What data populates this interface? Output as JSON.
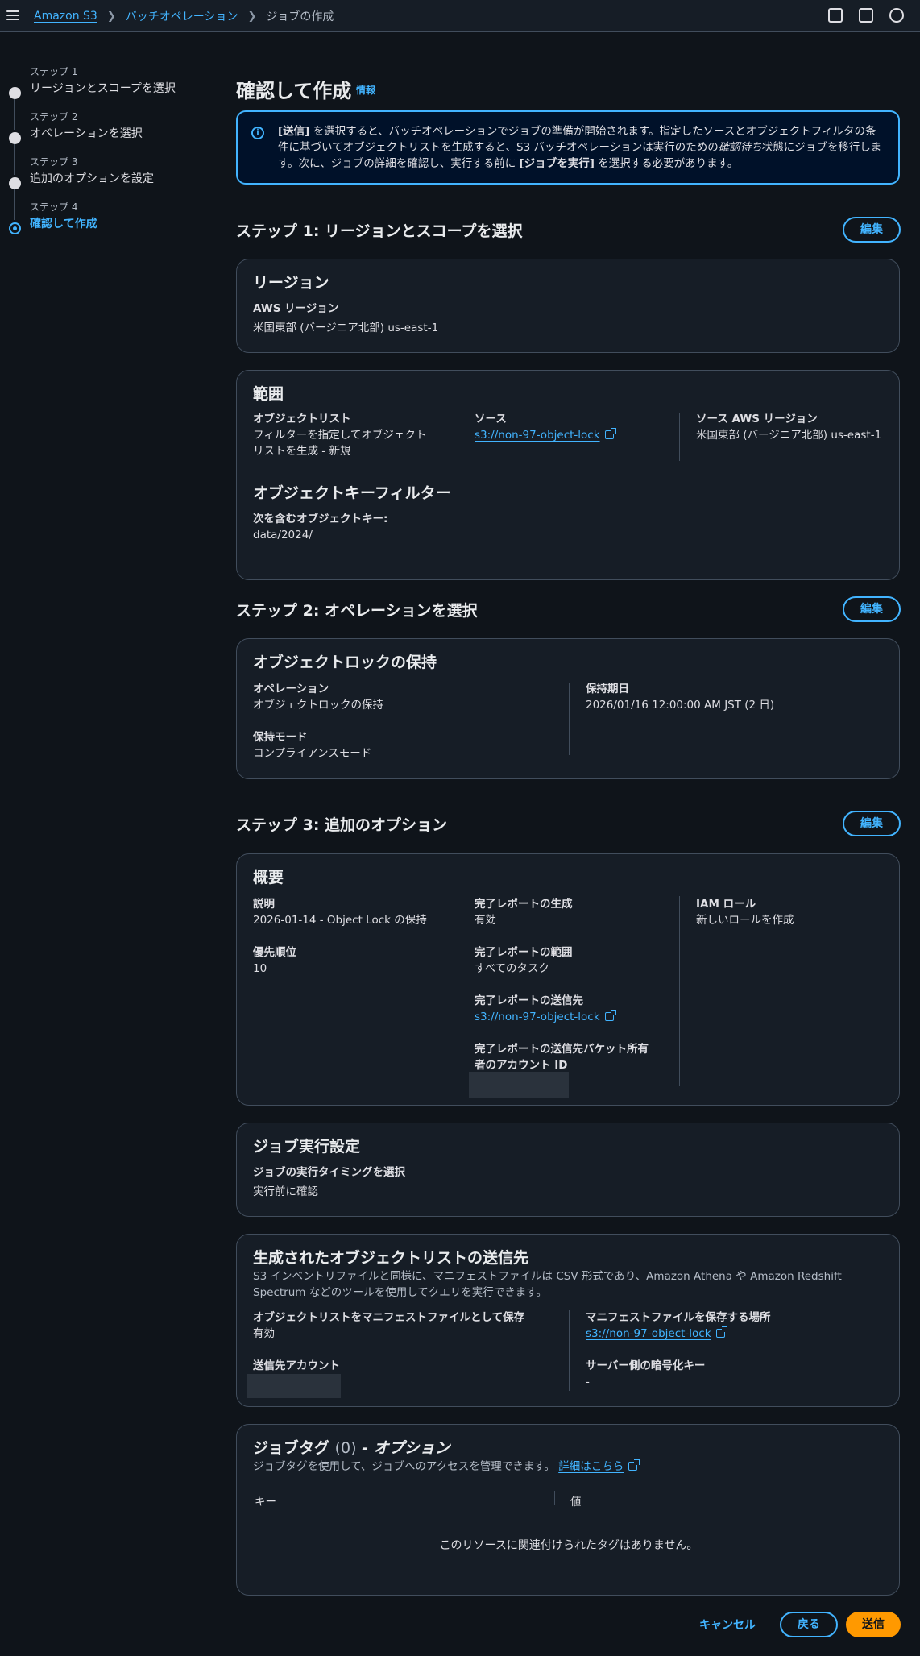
{
  "breadcrumbs": [
    "Amazon S3",
    "バッチオペレーション",
    "ジョブの作成"
  ],
  "steps": [
    {
      "num": "ステップ 1",
      "label": "リージョンとスコープを選択"
    },
    {
      "num": "ステップ 2",
      "label": "オペレーションを選択"
    },
    {
      "num": "ステップ 3",
      "label": "追加のオプションを設定"
    },
    {
      "num": "ステップ 4",
      "label": "確認して作成"
    }
  ],
  "page": {
    "title": "確認して作成",
    "info": "情報"
  },
  "alert": {
    "p1": "[送信]",
    "p2": " を選択すると、バッチオペレーションでジョブの準備が開始されます。指定したソースとオブジェクトフィルタの条件に基づいてオブジェクトリストを生成すると、S3 バッチオペレーションは実行のための",
    "p3": "確認待ち",
    "p4": "状態にジョブを移行します。次に、ジョブの詳細を確認し、実行する前に ",
    "p5": "[ジョブを実行]",
    "p6": " を選択する必要があります。"
  },
  "edit_label": "編集",
  "step1": {
    "heading": "ステップ 1: リージョンとスコープを選択",
    "region_card": {
      "title": "リージョン",
      "k": "AWS リージョン",
      "v": "米国東部 (バージニア北部) us-east-1"
    },
    "scope_card": {
      "title": "範囲",
      "object_list_k": "オブジェクトリスト",
      "object_list_v1": "フィルターを指定してオブジェクト",
      "object_list_v2": "リストを生成 - 新規",
      "source_k": "ソース",
      "source_v": "s3://non-97-object-lock",
      "source_region_k": "ソース AWS リージョン",
      "source_region_v": "米国東部 (バージニア北部) us-east-1",
      "filter_title": "オブジェクトキーフィルター",
      "filter_k": "次を含むオブジェクトキー:",
      "filter_v": "data/2024/"
    }
  },
  "step2": {
    "heading": "ステップ 2: オペレーションを選択",
    "card": {
      "title": "オブジェクトロックの保持",
      "op_k": "オペレーション",
      "op_v": "オブジェクトロックの保持",
      "mode_k": "保持モード",
      "mode_v": "コンプライアンスモード",
      "date_k": "保持期日",
      "date_v": "2026/01/16 12:00:00 AM JST (2 日)"
    }
  },
  "step3": {
    "heading": "ステップ 3: 追加のオプション",
    "overview": {
      "title": "概要",
      "desc_k": "説明",
      "desc_v": "2026-01-14 - Object Lock の保持",
      "prio_k": "優先順位",
      "prio_v": "10",
      "report_k": "完了レポートの生成",
      "report_v": "有効",
      "scope_k": "完了レポートの範囲",
      "scope_v": "すべてのタスク",
      "dest_k": "完了レポートの送信先",
      "dest_v": "s3://non-97-object-lock",
      "owner_k1": "完了レポートの送信先バケット所有",
      "owner_k2": "者のアカウント ID",
      "iam_k": "IAM ロール",
      "iam_v": "新しいロールを作成"
    },
    "exec": {
      "title": "ジョブ実行設定",
      "k": "ジョブの実行タイミングを選択",
      "v": "実行前に確認"
    },
    "manifest": {
      "title": "生成されたオブジェクトリストの送信先",
      "desc1": "S3 インベントリファイルと同様に、マニフェストファイルは CSV 形式であり、Amazon Athena や Amazon Redshift",
      "desc2": "Spectrum などのツールを使用してクエリを実行できます。",
      "save_k": "オブジェクトリストをマニフェストファイルとして保存",
      "save_v": "有効",
      "acct_k": "送信先アカウント",
      "loc_k": "マニフェストファイルを保存する場所",
      "loc_v": "s3://non-97-object-lock",
      "enc_k": "サーバー側の暗号化キー",
      "enc_v": "-"
    },
    "tags": {
      "title": "ジョブタグ",
      "count": "(0)",
      "optional": "- オプション",
      "desc": "ジョブタグを使用して、ジョブへのアクセスを管理できます。",
      "learn_more": "詳細はこちら",
      "col_key": "キー",
      "col_value": "値",
      "empty": "このリソースに関連付けられたタグはありません。"
    }
  },
  "footer": {
    "cancel": "キャンセル",
    "back": "戻る",
    "submit": "送信"
  }
}
